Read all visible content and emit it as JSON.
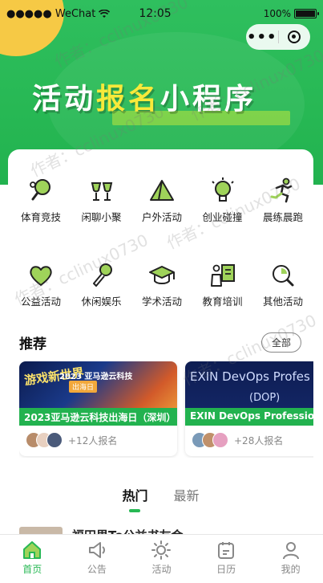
{
  "status_bar": {
    "carrier": "●●●●● WeChat",
    "time": "12:05",
    "battery": "100%"
  },
  "capsule": {
    "more_label": "•••"
  },
  "banner": {
    "part1": "活动",
    "highlight": "报名",
    "part2": "小程序"
  },
  "categories": [
    {
      "label": "体育竞技",
      "icon": "ping-pong-icon"
    },
    {
      "label": "闲聊小聚",
      "icon": "cheers-icon"
    },
    {
      "label": "户外活动",
      "icon": "tent-icon"
    },
    {
      "label": "创业碰撞",
      "icon": "lightbulb-icon"
    },
    {
      "label": "晨练晨跑",
      "icon": "runner-icon"
    },
    {
      "label": "公益活动",
      "icon": "heart-icon"
    },
    {
      "label": "休闲娱乐",
      "icon": "microphone-icon"
    },
    {
      "label": "学术活动",
      "icon": "graduation-cap-icon"
    },
    {
      "label": "教育培训",
      "icon": "teacher-icon"
    },
    {
      "label": "其他活动",
      "icon": "search-icon"
    }
  ],
  "recommend": {
    "title": "推荐",
    "all_label": "全部",
    "cards": [
      {
        "title": "2023亚马逊云科技出海日（深圳）",
        "count": "+12人报名",
        "img_logo": "游戏新世界",
        "img_line1": "2023 亚马逊云科技",
        "img_line2": "出海日"
      },
      {
        "title": "EXIN DevOps Professional",
        "count": "+28人报名",
        "img_line1": "EXIN DevOps Profes",
        "img_line2": "(DOP)"
      }
    ]
  },
  "tabs": [
    {
      "label": "热门"
    },
    {
      "label": "最新"
    }
  ],
  "peek": {
    "text": "福田男To公益书友会"
  },
  "tabbar": [
    {
      "label": "首页",
      "icon": "home-icon"
    },
    {
      "label": "公告",
      "icon": "megaphone-icon"
    },
    {
      "label": "活动",
      "icon": "sun-icon"
    },
    {
      "label": "日历",
      "icon": "calendar-icon"
    },
    {
      "label": "我的",
      "icon": "user-icon"
    }
  ],
  "watermark": "作者：cclinux0730",
  "colors": {
    "brand_green": "#27b854",
    "banner_highlight": "#f8e93a",
    "accent_yellow": "#f6c945"
  }
}
